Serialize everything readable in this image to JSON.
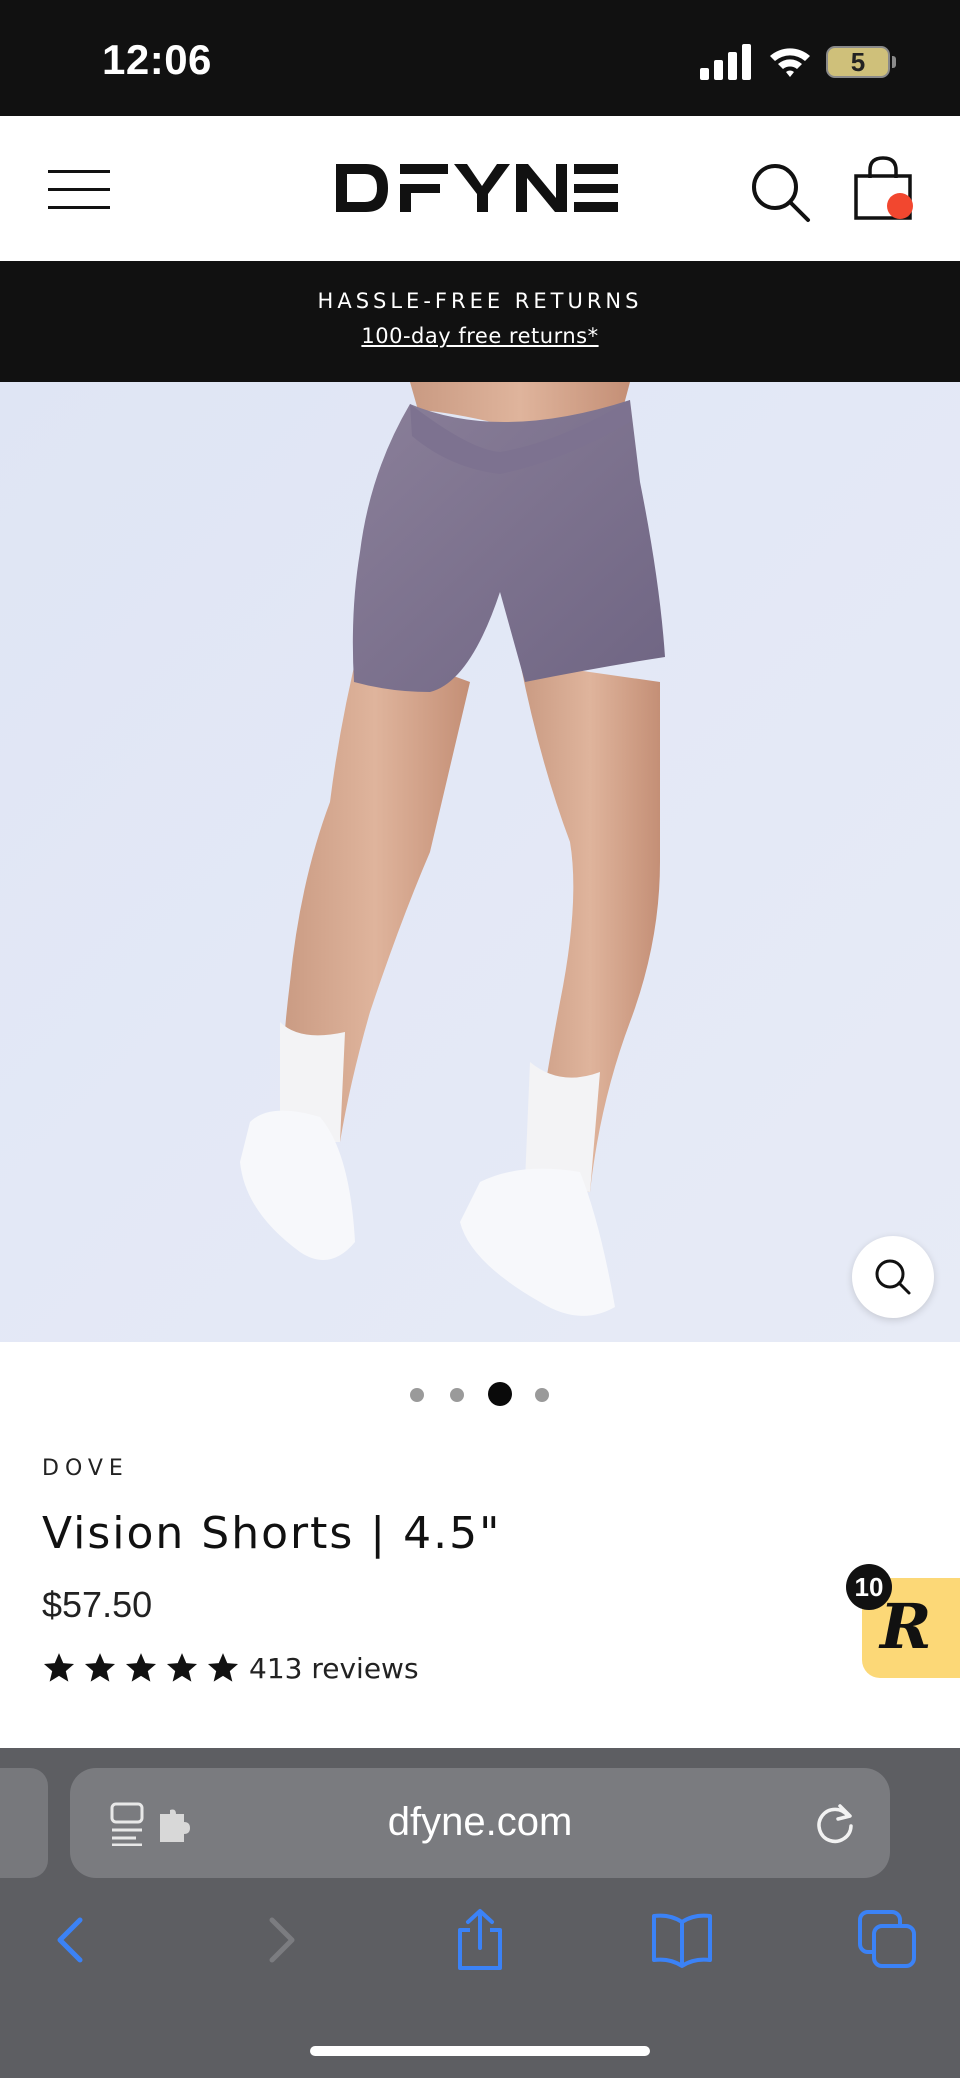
{
  "status_bar": {
    "time": "12:06",
    "battery_level": "5",
    "icons": [
      "signal-icon",
      "wifi-icon",
      "battery-icon"
    ]
  },
  "header": {
    "logo_text": "DFYNE",
    "icons": [
      "menu-icon",
      "search-icon",
      "cart-icon"
    ],
    "cart_dot_color": "#f2472f"
  },
  "announcement": {
    "title": "HASSLE-FREE RETURNS",
    "link": "100-day free returns*"
  },
  "gallery": {
    "slide_count": 4,
    "active_slide": 3,
    "zoom_icon": "search-icon",
    "dot_color": "#9a9a9a",
    "active_dot_color": "#0a0a0a",
    "background_color": "#e2e7f5"
  },
  "product": {
    "color": "DOVE",
    "title": "Vision Shorts | 4.5\"",
    "price": "$57.50",
    "rating_stars": 5,
    "review_count": "413 reviews"
  },
  "rewards_widget": {
    "badge": "10",
    "glyph": "R",
    "color": "#fcd877"
  },
  "browser": {
    "url": "dfyne.com",
    "icons": [
      "reader-icon",
      "extensions-icon",
      "reload-icon",
      "back-icon",
      "forward-icon",
      "share-icon",
      "bookmarks-icon",
      "tabs-icon"
    ],
    "accent_color": "#3b82f6"
  }
}
